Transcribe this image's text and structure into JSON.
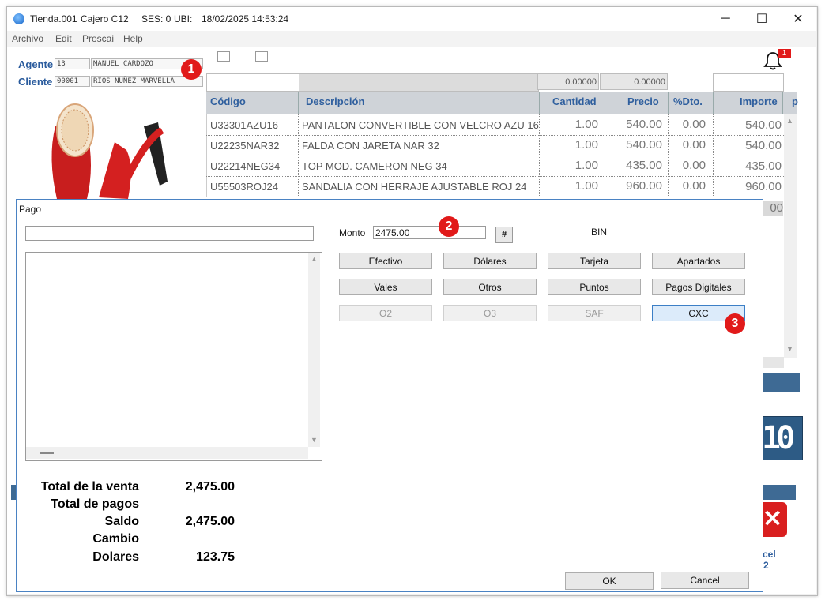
{
  "titlebar": {
    "store": "Tienda.001",
    "cashier": "Cajero C12",
    "session": "SES: 0",
    "ubi": "UBI:",
    "datetime": "18/02/2025 14:53:24",
    "controls": {
      "minimize": "─",
      "maximize": "☐",
      "close": "✕"
    }
  },
  "menu": [
    "Archivo",
    "Edit",
    "Proscai",
    "Help"
  ],
  "header": {
    "agent_label": "Agente",
    "agent_code": "13",
    "agent_name": "MANUEL CARDOZO",
    "client_label": "Cliente",
    "client_code": "00001",
    "client_name": "RIOS NUÑEZ MARVELLA",
    "notification_count": "1",
    "total1": "0.00000",
    "total2": "0.00000"
  },
  "grid": {
    "columns": [
      "Código",
      "Descripción",
      "Cantidad",
      "Precio",
      "%Dto.",
      "Importe",
      "p"
    ],
    "rows": [
      {
        "codigo": "U33301AZU16",
        "descripcion": "PANTALON CONVERTIBLE CON VELCRO AZU 16",
        "cantidad": "1.00",
        "precio": "540.00",
        "dto": "0.00",
        "importe": "540.00"
      },
      {
        "codigo": "U22235NAR32",
        "descripcion": "FALDA CON JARETA NAR 32",
        "cantidad": "1.00",
        "precio": "540.00",
        "dto": "0.00",
        "importe": "540.00"
      },
      {
        "codigo": "U22214NEG34",
        "descripcion": "TOP MOD. CAMERON NEG 34",
        "cantidad": "1.00",
        "precio": "435.00",
        "dto": "0.00",
        "importe": "435.00"
      },
      {
        "codigo": "U55503ROJ24",
        "descripcion": "SANDALIA CON HERRAJE AJUSTABLE ROJ 24",
        "cantidad": "1.00",
        "precio": "960.00",
        "dto": "0.00",
        "importe": "960.00"
      }
    ],
    "partial_importe": "00"
  },
  "background_right": {
    "display_digits": "10",
    "cancel_text": "cel",
    "cancel_num": "2"
  },
  "dialog": {
    "title": "Pago",
    "monto_label": "Monto",
    "monto_value": "2475.00",
    "hash_button": "#",
    "bin_label": "BIN",
    "buttons_row1": [
      "Efectivo",
      "Dólares",
      "Tarjeta",
      "Apartados"
    ],
    "buttons_row2": [
      "Vales",
      "Otros",
      "Puntos",
      "Pagos Digitales"
    ],
    "buttons_row3": [
      "O2",
      "O3",
      "SAF",
      "CXC"
    ],
    "totals": [
      {
        "label": "Total de la venta",
        "value": "2,475.00"
      },
      {
        "label": "Total de pagos",
        "value": ""
      },
      {
        "label": "Saldo",
        "value": "2,475.00"
      },
      {
        "label": "Cambio",
        "value": ""
      },
      {
        "label": "Dolares",
        "value": "123.75"
      }
    ],
    "ok": "OK",
    "cancel": "Cancel"
  },
  "markers": [
    "1",
    "2",
    "3"
  ],
  "colors": {
    "accent_blue": "#2f5f9e",
    "marker_red": "#e11a1a",
    "dialog_border": "#4a82c3"
  }
}
